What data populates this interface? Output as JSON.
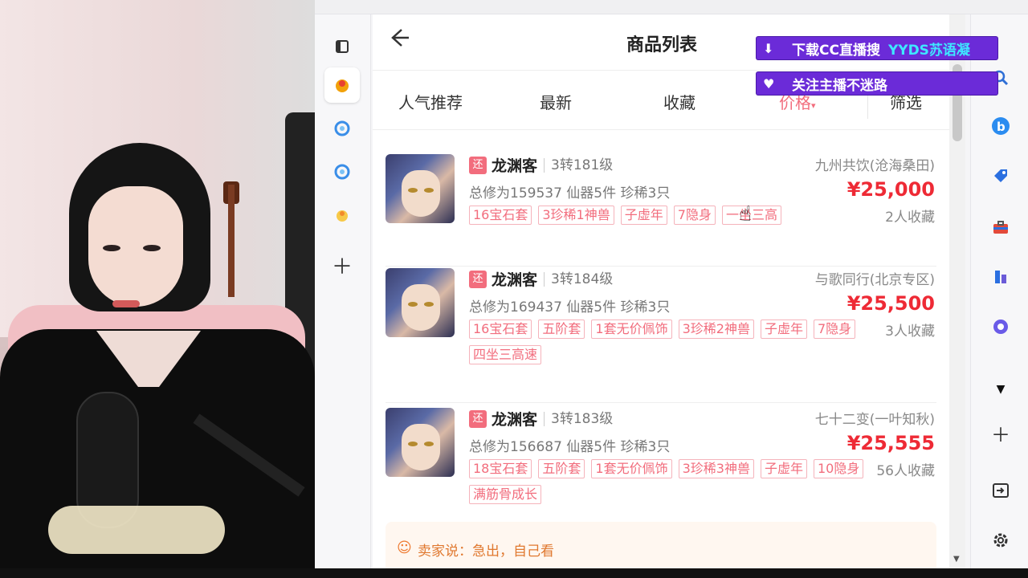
{
  "page": {
    "title": "商品列表",
    "back_icon": "arrow-left-icon"
  },
  "tabs": [
    {
      "label": "人气推荐"
    },
    {
      "label": "最新"
    },
    {
      "label": "收藏"
    },
    {
      "label": "价格"
    },
    {
      "label": "筛选"
    }
  ],
  "items": [
    {
      "badge": "还",
      "name": "龙渊客",
      "level": "3转181级",
      "server": "九州共饮(沧海桑田)",
      "stats": "总修为159537  仙器5件  珍稀3只",
      "price": "¥25,000",
      "favorites": "2人收藏",
      "tags": [
        "16宝石套",
        "3珍稀1神兽",
        "子虚年",
        "7隐身",
        "一坐三高"
      ]
    },
    {
      "badge": "还",
      "name": "龙渊客",
      "level": "3转184级",
      "server": "与歌同行(北京专区)",
      "stats": "总修为169437  仙器5件  珍稀3只",
      "price": "¥25,500",
      "favorites": "3人收藏",
      "tags": [
        "16宝石套",
        "五阶套",
        "1套无价佩饰",
        "3珍稀2神兽",
        "子虚年",
        "7隐身",
        "四坐三高速"
      ]
    },
    {
      "badge": "还",
      "name": "龙渊客",
      "level": "3转183级",
      "server": "七十二变(一叶知秋)",
      "stats": "总修为156687  仙器5件  珍稀3只",
      "price": "¥25,555",
      "favorites": "56人收藏",
      "tags": [
        "18宝石套",
        "五阶套",
        "1套无价佩饰",
        "3珍稀3神兽",
        "子虚年",
        "10隐身",
        "满筋骨成长"
      ]
    }
  ],
  "seller_note": "卖家说：急出，自己看",
  "overlay": {
    "banner1_text": "下载CC直播搜",
    "banner1_highlight": "YYDS苏语凝",
    "banner2_text": "关注主播不迷路"
  },
  "colors": {
    "accent_pink": "#f26d7d",
    "price_red": "#ee2a35",
    "banner_purple": "#6b2bd8",
    "banner_cyan": "#3ee8ff"
  }
}
